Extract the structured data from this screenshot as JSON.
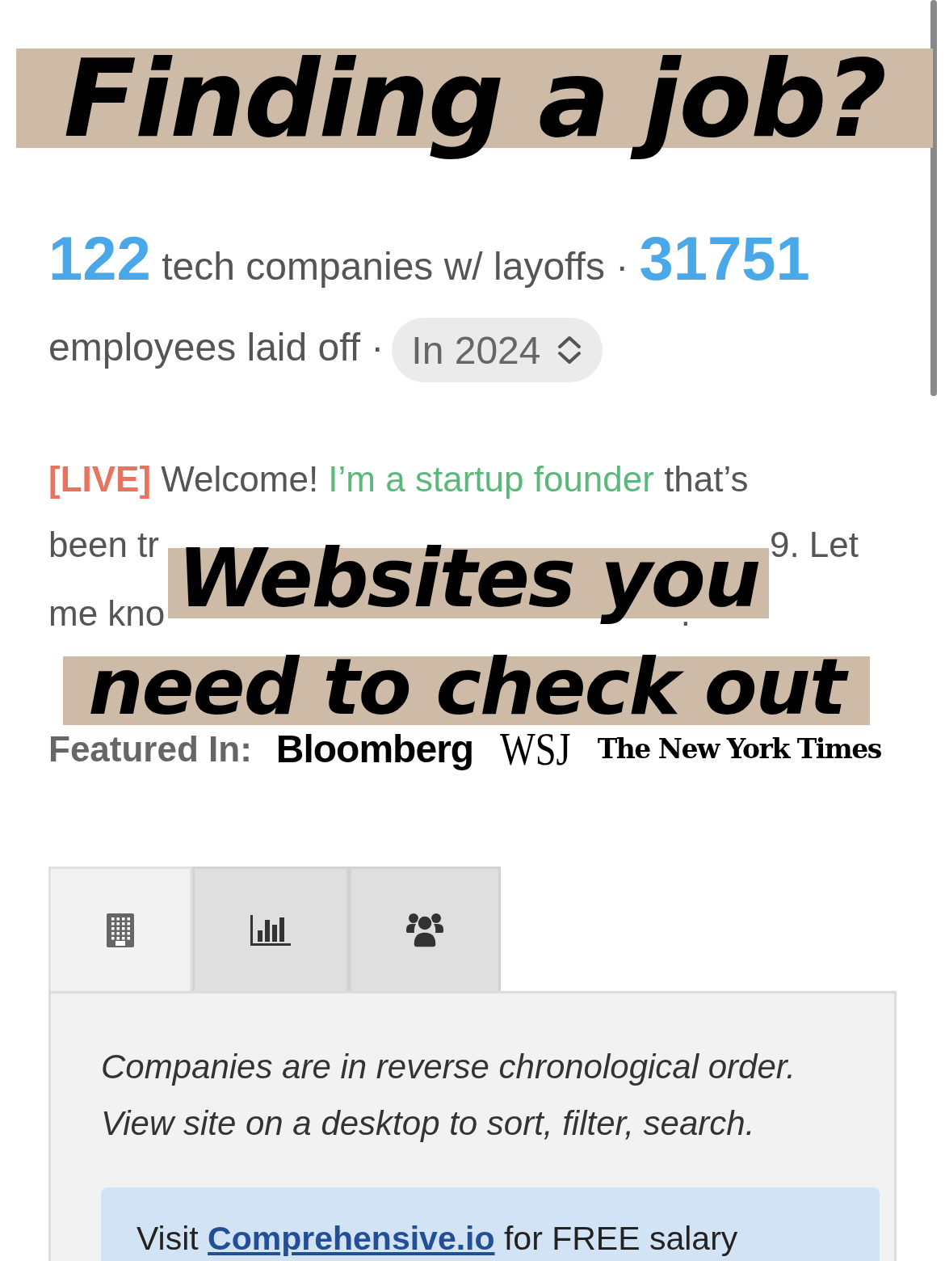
{
  "stats": {
    "companies_count": "122",
    "companies_label": "tech companies w/ layoffs ·",
    "employees_count": "31751",
    "employees_label": "employees laid off ·",
    "period": {
      "value": "In 2024"
    }
  },
  "intro": {
    "first_line": [
      {
        "kind": "badge",
        "text": "[LIVE]"
      },
      {
        "kind": "plain",
        "text": " Welcome! "
      },
      {
        "kind": "link",
        "text": "I’m a startup founder"
      },
      {
        "kind": "plain",
        "text": " that’s"
      }
    ],
    "partly_covered_lines": [
      [
        "been tr",
        "9. Let"
      ],
      [
        "me kno",
        "."
      ]
    ]
  },
  "featured": {
    "label": "Featured In:",
    "outlets": [
      {
        "kind": "sans",
        "text": "Bloomberg"
      },
      {
        "kind": "serif",
        "text": "WSJ"
      },
      {
        "kind": "blackletter",
        "text": "The New York Times"
      }
    ]
  },
  "tabs": [
    {
      "kind": "companies",
      "selected": true
    },
    {
      "kind": "chart",
      "selected": false
    },
    {
      "kind": "people",
      "selected": false
    }
  ],
  "panel": {
    "notes": [
      "Companies are in reverse chronological order.",
      "View site on a desktop to sort, filter, search."
    ],
    "promo": {
      "before": "Visit ",
      "link": "Comprehensive.io",
      "after": " for FREE salary"
    }
  },
  "overlay_captions": [
    {
      "text": "Finding a job?"
    },
    {
      "text": "Websites you"
    },
    {
      "text": "need to check out"
    }
  ]
}
